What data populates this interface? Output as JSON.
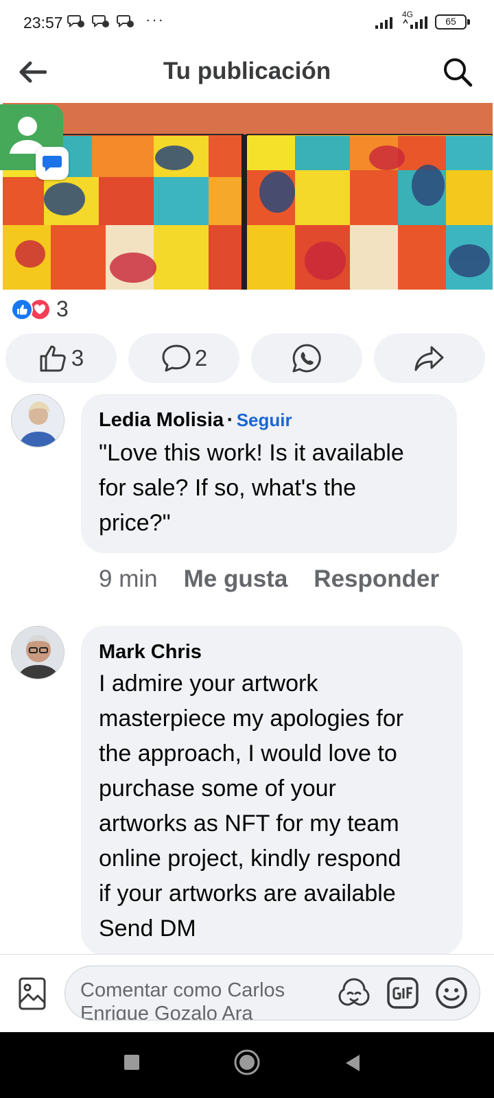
{
  "status_bar": {
    "time": "23:57",
    "more": "···",
    "network": "4G",
    "battery": "65"
  },
  "header": {
    "title": "Tu publicación",
    "back_icon": "arrow-left-icon",
    "search_icon": "search-icon"
  },
  "post": {
    "reactions_count": "3",
    "actions": {
      "like_count": "3",
      "comment_count": "2"
    }
  },
  "comments": [
    {
      "name": "Ledia Molisia",
      "separator": "·",
      "follow_label": "Seguir",
      "text": "\"Love this work! Is it available\nfor sale? If so, what's the\nprice?\"",
      "time": "9 min",
      "like_label": "Me gusta",
      "reply_label": "Responder"
    },
    {
      "name": "Mark Chris",
      "text": "I admire your artwork\nmasterpiece my apologies for\nthe  approach, I would love to\npurchase some of your\nartworks as NFT for my team\nonline project, kindly respond\nif your artworks are available\nSend DM"
    }
  ],
  "composer": {
    "placeholder": "Comentar como Carlos\nEnrique Gozalo Ara"
  },
  "colors": {
    "accent": "#1a66d2",
    "like_blue": "#1877f2",
    "love_red": "#f33e58",
    "bubble_bg": "#f0f2f5"
  }
}
